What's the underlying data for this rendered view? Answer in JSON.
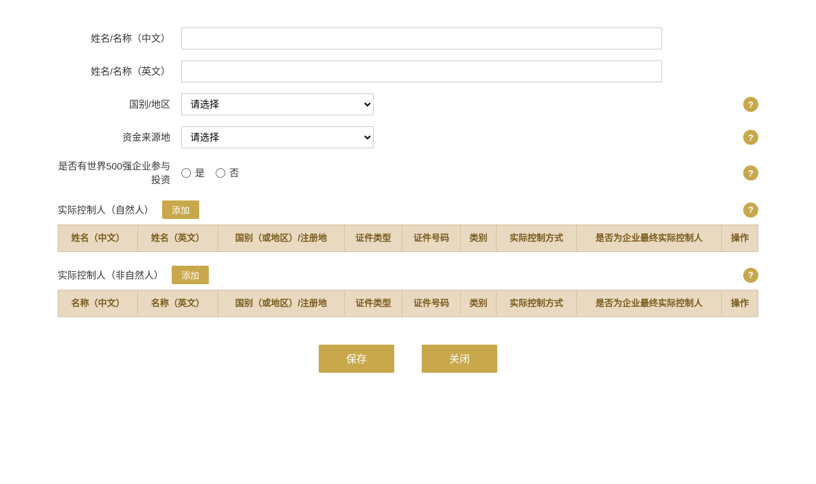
{
  "form": {
    "name_cn_label": "姓名/名称（中文）",
    "name_en_label": "姓名/名称（英文）",
    "country_label": "国别/地区",
    "fund_source_label": "资金来源地",
    "fortune500_label": "是否有世界500强企业参与投资",
    "please_select": "请选择",
    "yes_label": "是",
    "no_label": "否",
    "name_cn_placeholder": "",
    "name_en_placeholder": ""
  },
  "natural_person_section": {
    "title": "实际控制人（自然人）",
    "add_label": "添加",
    "columns": [
      "姓名（中文）",
      "姓名（英文）",
      "国别（或地区）/注册地",
      "证件类型",
      "证件号码",
      "类别",
      "实际控制方式",
      "是否为企业最终实际控制人",
      "操作"
    ]
  },
  "non_natural_person_section": {
    "title": "实际控制人（非自然人）",
    "add_label": "添加",
    "columns": [
      "名称（中文）",
      "名称（英文）",
      "国别（或地区）/注册地",
      "证件类型",
      "证件号码",
      "类别",
      "实际控制方式",
      "是否为企业最终实际控制人",
      "操作"
    ]
  },
  "buttons": {
    "save": "保存",
    "close": "关闭"
  },
  "help_icon_symbol": "?",
  "icons": {
    "help": "?"
  }
}
